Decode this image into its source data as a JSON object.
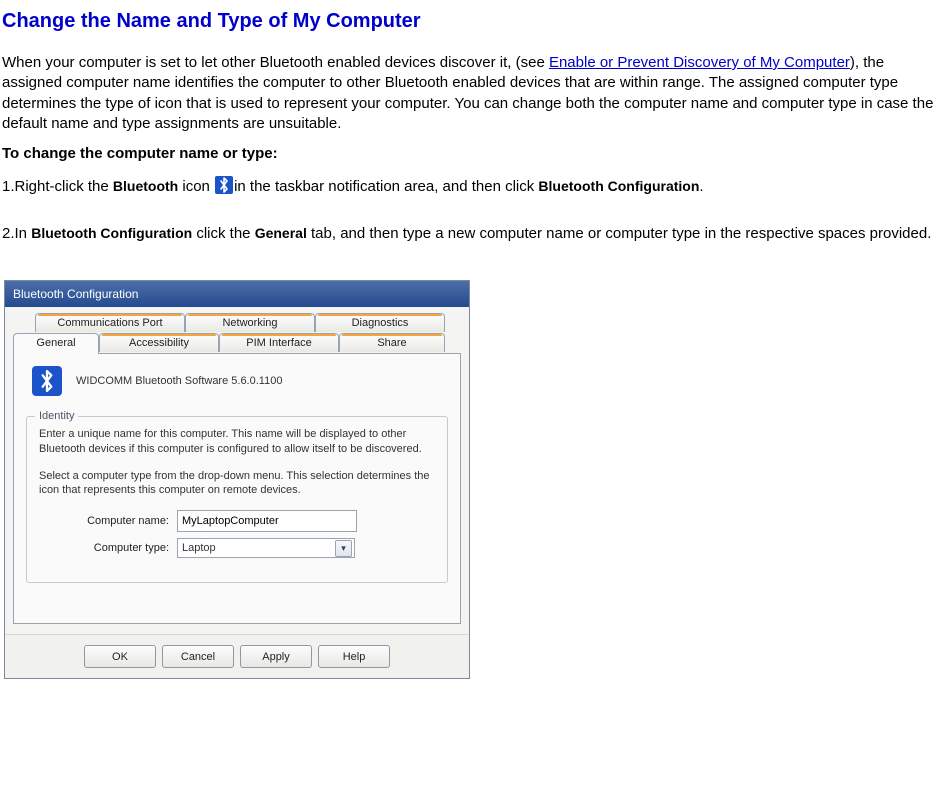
{
  "page": {
    "title": "Change the Name and Type of My Computer",
    "intro_before_link": "When your computer is set to let other Bluetooth enabled devices discover it, (see ",
    "link_text": "Enable or Prevent Discovery of My Computer",
    "intro_after_link": "), the assigned computer name identifies the computer to other Bluetooth enabled devices that are within range. The assigned computer type determines the type of icon that is used to represent your computer. You can change both the computer name and computer type in case the default name and type assignments are unsuitable.",
    "subheading": "To change the computer name or type:"
  },
  "steps": {
    "s1_num": "1.",
    "s1_a": "Right-click the ",
    "s1_bold1": "Bluetooth",
    "s1_b": " icon ",
    "s1_c": "in the taskbar notification area, and then click ",
    "s1_bold2": "Bluetooth Configuration",
    "s1_d": ".",
    "s2_num": "2.",
    "s2_a": "In ",
    "s2_bold1": "Bluetooth Configuration",
    "s2_b": " click the ",
    "s2_bold2": "General",
    "s2_c": " tab, and then type a new computer name or computer type in the respective spaces provided."
  },
  "dialog": {
    "title": "Bluetooth Configuration",
    "tabs_row1": {
      "t1": "Communications Port",
      "t2": "Networking",
      "t3": "Diagnostics"
    },
    "tabs_row2": {
      "t1": "General",
      "t2": "Accessibility",
      "t3": "PIM Interface",
      "t4": "Share"
    },
    "software": "WIDCOMM Bluetooth Software 5.6.0.1100",
    "identity": {
      "legend": "Identity",
      "p1": "Enter a unique name for this computer.  This name will be displayed to other Bluetooth devices if this computer is configured to allow itself to be discovered.",
      "p2": "Select a computer type from the drop-down menu.  This selection determines the icon that represents this computer on remote devices.",
      "name_label": "Computer name:",
      "name_value": "MyLaptopComputer",
      "type_label": "Computer type:",
      "type_value": "Laptop"
    },
    "buttons": {
      "ok": "OK",
      "cancel": "Cancel",
      "apply": "Apply",
      "help": "Help"
    }
  }
}
